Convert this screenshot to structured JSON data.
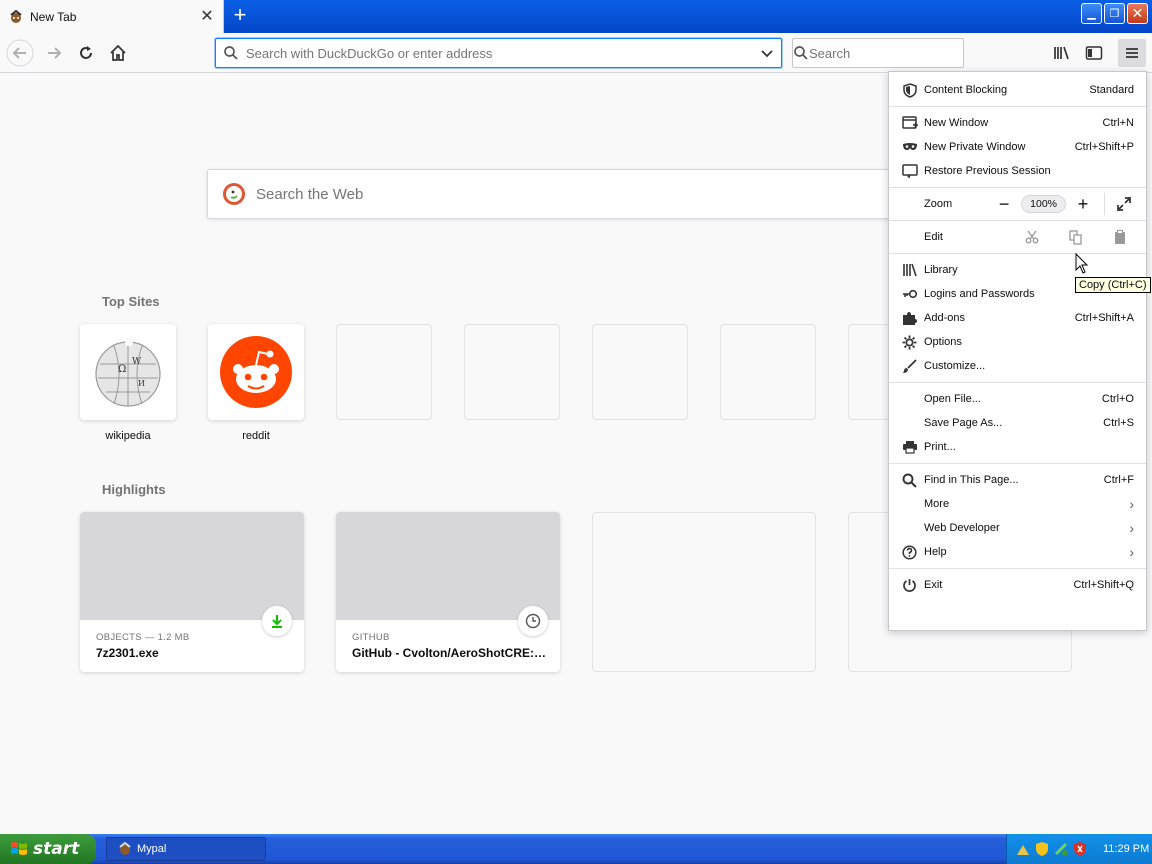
{
  "tab": {
    "title": "New Tab"
  },
  "urlbar": {
    "placeholder": "Search with DuckDuckGo or enter address"
  },
  "searchbar": {
    "placeholder": "Search"
  },
  "newtab": {
    "web_search_placeholder": "Search the Web",
    "top_sites_title": "Top Sites",
    "top_sites": [
      {
        "label": "wikipedia"
      },
      {
        "label": "reddit"
      }
    ],
    "highlights_title": "Highlights",
    "highlights": [
      {
        "meta": "OBJECTS — 1.2 MB",
        "title": "7z2301.exe",
        "badge": "download-icon"
      },
      {
        "meta": "GITHUB",
        "title": "GitHub - Cvolton/AeroShotCRE: ...",
        "badge": "clock-icon"
      }
    ]
  },
  "menu": {
    "content_blocking": {
      "label": "Content Blocking",
      "value": "Standard"
    },
    "new_window": {
      "label": "New Window",
      "shortcut": "Ctrl+N"
    },
    "new_private_window": {
      "label": "New Private Window",
      "shortcut": "Ctrl+Shift+P"
    },
    "restore_session": {
      "label": "Restore Previous Session"
    },
    "zoom": {
      "label": "Zoom",
      "minus": "−",
      "value": "100%",
      "plus": "+"
    },
    "edit": {
      "label": "Edit"
    },
    "library": {
      "label": "Library"
    },
    "logins": {
      "label": "Logins and Passwords"
    },
    "addons": {
      "label": "Add-ons",
      "shortcut": "Ctrl+Shift+A"
    },
    "options": {
      "label": "Options"
    },
    "customize": {
      "label": "Customize..."
    },
    "open_file": {
      "label": "Open File...",
      "shortcut": "Ctrl+O"
    },
    "save_page": {
      "label": "Save Page As...",
      "shortcut": "Ctrl+S"
    },
    "print": {
      "label": "Print..."
    },
    "find": {
      "label": "Find in This Page...",
      "shortcut": "Ctrl+F"
    },
    "more": {
      "label": "More"
    },
    "web_developer": {
      "label": "Web Developer"
    },
    "help": {
      "label": "Help"
    },
    "exit": {
      "label": "Exit",
      "shortcut": "Ctrl+Shift+Q"
    }
  },
  "tooltip": {
    "text": "Copy (Ctrl+C)"
  },
  "taskbar": {
    "start_label": "start",
    "task_label": "Mypal",
    "clock": "11:29 PM"
  },
  "colors": {
    "accent": "#0a84ff",
    "reddit": "#ff4500",
    "download_green": "#12bc00",
    "taskbar_blue": "#245edb",
    "start_green": "#2f8a2f"
  }
}
